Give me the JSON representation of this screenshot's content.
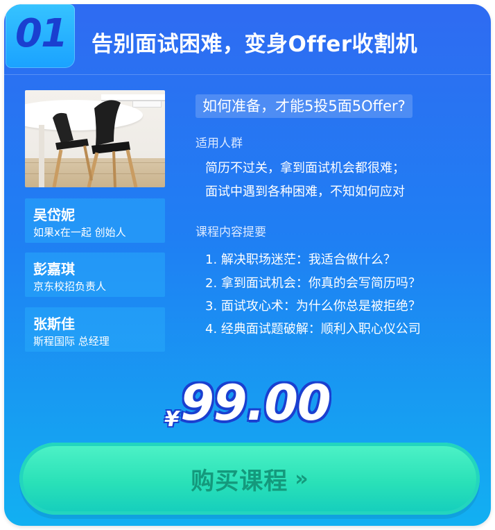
{
  "header": {
    "number": "01",
    "title": "告别面试困难，变身Offer收割机"
  },
  "mentors": [
    {
      "name": "吴岱妮",
      "role": "如果x在一起 创始人"
    },
    {
      "name": "彭嘉琪",
      "role": "京东校招负责人"
    },
    {
      "name": "张斯佳",
      "role": "斯程国际 总经理"
    }
  ],
  "question": "如何准备，才能5投5面5Offer?",
  "audience": {
    "title": "适用人群",
    "lines": [
      "简历不过关，拿到面试机会都很难；",
      "面试中遇到各种困难，不知如何应对"
    ]
  },
  "outline": {
    "title": "课程内容提要",
    "items": [
      "1. 解决职场迷茫：我适合做什么？",
      "2. 拿到面试机会：你真的会写简历吗？",
      "3. 面试攻心术：为什么你总是被拒绝？",
      "4. 经典面试题破解：顺利入职心仪公司"
    ]
  },
  "price": {
    "currency": "¥",
    "amount": "99.00"
  },
  "buy_button": {
    "label": "购买课程",
    "arrow": "»"
  },
  "colors": {
    "card_top": "#2f6bf2",
    "card_bottom": "#12b0f2",
    "button": "#2ae1b8",
    "price_outline": "#1a3fd0"
  }
}
